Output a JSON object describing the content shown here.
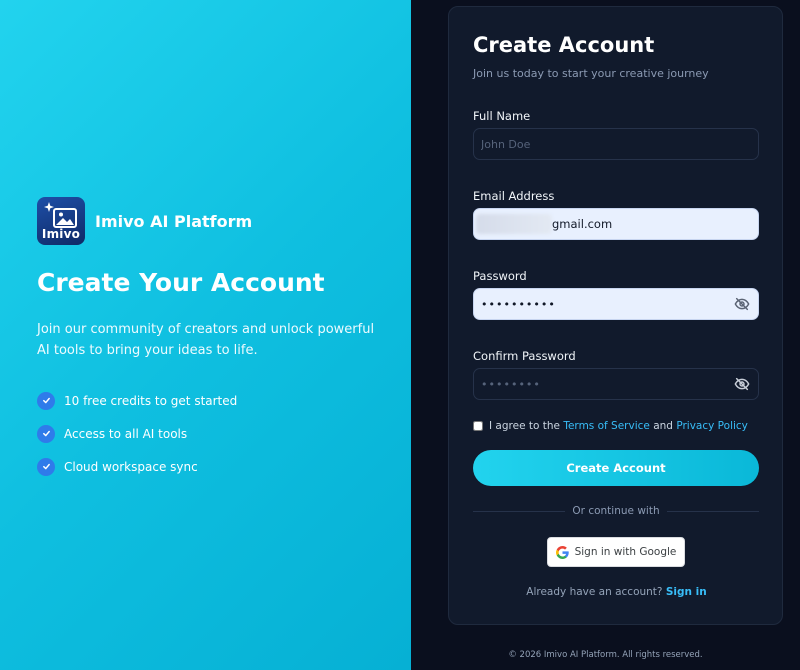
{
  "left": {
    "brand": {
      "logo_text": "Imivo",
      "name": "Imivo AI Platform"
    },
    "title": "Create Your Account",
    "description": "Join our community of creators and unlock powerful AI tools to bring your ideas to life.",
    "features": [
      "10 free credits to get started",
      "Access to all AI tools",
      "Cloud workspace sync"
    ]
  },
  "form": {
    "title": "Create Account",
    "subtitle": "Join us today to start your creative journey",
    "full_name": {
      "label": "Full Name",
      "placeholder": "John Doe",
      "value": ""
    },
    "email": {
      "label": "Email Address",
      "value_visible": "gmail.com"
    },
    "password": {
      "label": "Password",
      "value": "••••••••••"
    },
    "confirm_password": {
      "label": "Confirm Password",
      "placeholder": "••••••••",
      "value": ""
    },
    "terms": {
      "prefix": "I agree to the",
      "terms_link": "Terms of Service",
      "and": "and",
      "privacy_link": "Privacy Policy",
      "checked": false
    },
    "submit_label": "Create Account",
    "divider": "Or continue with",
    "google_label": "Sign in with Google",
    "signin_prompt": "Already have an account?",
    "signin_link": "Sign in"
  },
  "footer": "© 2026 Imivo AI Platform. All rights reserved.",
  "colors": {
    "accent": "#22d3ee",
    "link": "#38bdf8",
    "check": "#2f7bea",
    "card_bg": "#111a2c",
    "page_bg": "#0a0f1e"
  },
  "icons": {
    "eye": "eye-off-icon",
    "check": "check-icon",
    "google": "google-g-icon",
    "logo": "image-sparkle-icon"
  }
}
